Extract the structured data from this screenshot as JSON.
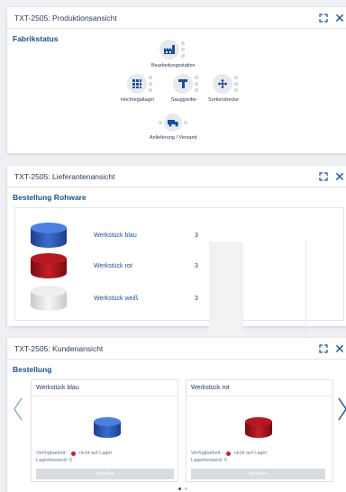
{
  "panels": {
    "production": {
      "title": "TXT-2505: Produktionsansicht",
      "section": "Fabrikstatus",
      "stations": {
        "processing": "Bearbeitungsstation",
        "high_bay": "Hochregallager",
        "suction": "Sauggreifer",
        "sorting": "Sortierstrecke",
        "delivery": "Anlieferung / Versand"
      }
    },
    "supplier": {
      "title": "TXT-2505: Lieferantenansicht",
      "section": "Bestellung Rohware",
      "items": [
        {
          "label": "Werkstück blau",
          "qty": "3",
          "color": "#2b55a8"
        },
        {
          "label": "Werkstück rot",
          "qty": "3",
          "color": "#a8141b"
        },
        {
          "label": "Werkstück weiß",
          "qty": "3",
          "color": "#e6e6e6"
        }
      ]
    },
    "customer": {
      "title": "TXT-2505: Kundenansicht",
      "section": "Bestellung",
      "cards": [
        {
          "title": "Werkstück blau",
          "avail_label": "Verfügbarkeit:",
          "avail_value": "nicht auf Lager",
          "stock_label": "Lagerbestand:",
          "stock_value": "0",
          "button": "bestellen",
          "color": "#2b55a8"
        },
        {
          "title": "Werkstück rot",
          "avail_label": "Verfügbarkeit:",
          "avail_value": "nicht auf Lager",
          "stock_label": "Lagerbestand:",
          "stock_value": "0",
          "button": "bestellen",
          "color": "#a8141b"
        }
      ],
      "pager": {
        "pages": 2,
        "active": 1
      }
    }
  },
  "colors": {
    "accent": "#1d4f91",
    "status_red": "#d0202a"
  },
  "icons": [
    "expand-icon",
    "close-icon",
    "factory-icon",
    "warehouse-icon",
    "gripper-icon",
    "sorting-icon",
    "truck-icon",
    "chevron-left-icon",
    "chevron-right-icon"
  ]
}
